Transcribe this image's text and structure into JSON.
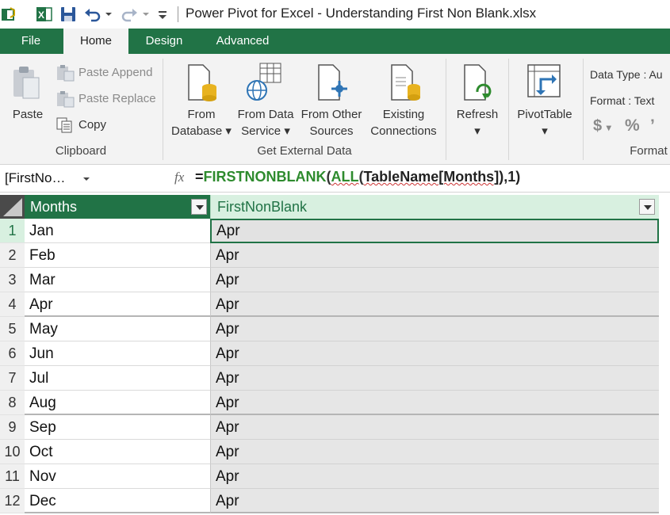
{
  "window": {
    "title": "Power Pivot for Excel - Understanding First Non Blank.xlsx"
  },
  "tabs": [
    "File",
    "Home",
    "Design",
    "Advanced"
  ],
  "ribbon": {
    "clipboard": {
      "paste": "Paste",
      "paste_append": "Paste Append",
      "paste_replace": "Paste Replace",
      "copy": "Copy",
      "group_label": "Clipboard"
    },
    "external": {
      "from_database": [
        "From",
        "Database"
      ],
      "from_data_service": [
        "From Data",
        "Service"
      ],
      "from_other_sources": [
        "From Other",
        "Sources"
      ],
      "existing_connections": [
        "Existing",
        "Connections"
      ],
      "group_label": "Get External Data"
    },
    "refresh": "Refresh",
    "pivottable": "PivotTable",
    "formatting": {
      "data_type": "Data Type : Au",
      "format": "Format : Text",
      "currency": "$",
      "percent": "%",
      "comma": "’",
      "group_label": "Format"
    }
  },
  "formula_bar": {
    "name_box": "[FirstNo…",
    "fx": "fx",
    "formula": {
      "eq": "=",
      "f1": "FIRSTNONBLANK",
      "p1": "(",
      "f2": "ALL",
      "p2": "(",
      "tbl": "TableName[Months]",
      "p3": "),1)"
    }
  },
  "table": {
    "columns": [
      "Months",
      "FirstNonBlank"
    ],
    "rows": [
      {
        "num": "1",
        "month": "Jan",
        "value": "Apr"
      },
      {
        "num": "2",
        "month": "Feb",
        "value": "Apr"
      },
      {
        "num": "3",
        "month": "Mar",
        "value": "Apr"
      },
      {
        "num": "4",
        "month": "Apr",
        "value": "Apr"
      },
      {
        "num": "5",
        "month": "May",
        "value": "Apr"
      },
      {
        "num": "6",
        "month": "Jun",
        "value": "Apr"
      },
      {
        "num": "7",
        "month": "Jul",
        "value": "Apr"
      },
      {
        "num": "8",
        "month": "Aug",
        "value": "Apr"
      },
      {
        "num": "9",
        "month": "Sep",
        "value": "Apr"
      },
      {
        "num": "10",
        "month": "Oct",
        "value": "Apr"
      },
      {
        "num": "11",
        "month": "Nov",
        "value": "Apr"
      },
      {
        "num": "12",
        "month": "Dec",
        "value": "Apr"
      }
    ]
  },
  "colors": {
    "accent": "#217346",
    "selected_column_header": "#d8f0e0",
    "selected_cell_border": "#217346",
    "row_band": "#e6e6e6"
  }
}
